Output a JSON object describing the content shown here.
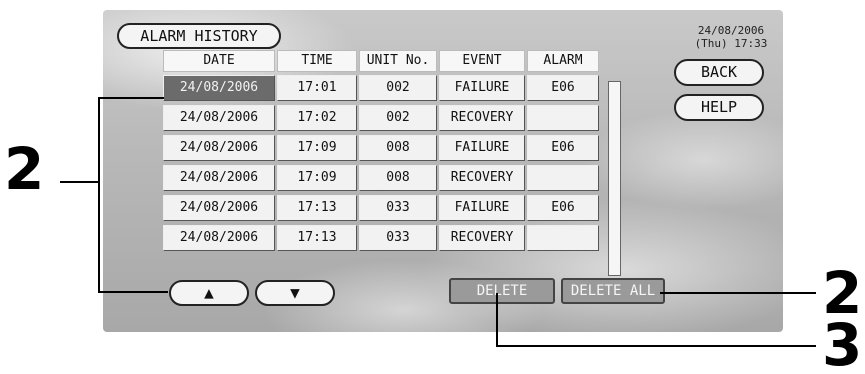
{
  "screen": {
    "title": "ALARM HISTORY",
    "clock": {
      "date": "24/08/2006",
      "time": "(Thu) 17:33"
    },
    "buttons": {
      "back": "BACK",
      "help": "HELP",
      "up": "▲",
      "down": "▼",
      "delete": "DELETE",
      "delete_all": "DELETE ALL"
    },
    "table": {
      "headers": [
        "DATE",
        "TIME",
        "UNIT No.",
        "EVENT",
        "ALARM"
      ],
      "rows": [
        [
          "24/08/2006",
          "17:01",
          "002",
          "FAILURE",
          "E06"
        ],
        [
          "24/08/2006",
          "17:02",
          "002",
          "RECOVERY",
          ""
        ],
        [
          "24/08/2006",
          "17:09",
          "008",
          "FAILURE",
          "E06"
        ],
        [
          "24/08/2006",
          "17:09",
          "008",
          "RECOVERY",
          ""
        ],
        [
          "24/08/2006",
          "17:13",
          "033",
          "FAILURE",
          "E06"
        ],
        [
          "24/08/2006",
          "17:13",
          "033",
          "RECOVERY",
          ""
        ]
      ],
      "selected_row": 0
    }
  },
  "callouts": {
    "left": "2",
    "right_top": "2",
    "right_bottom": "3"
  },
  "colors": {
    "selected_cell": "#6b6b6b",
    "disabled_button": "#9a9a9a"
  },
  "icons": {
    "up": "up-arrow-icon",
    "down": "down-arrow-icon"
  }
}
